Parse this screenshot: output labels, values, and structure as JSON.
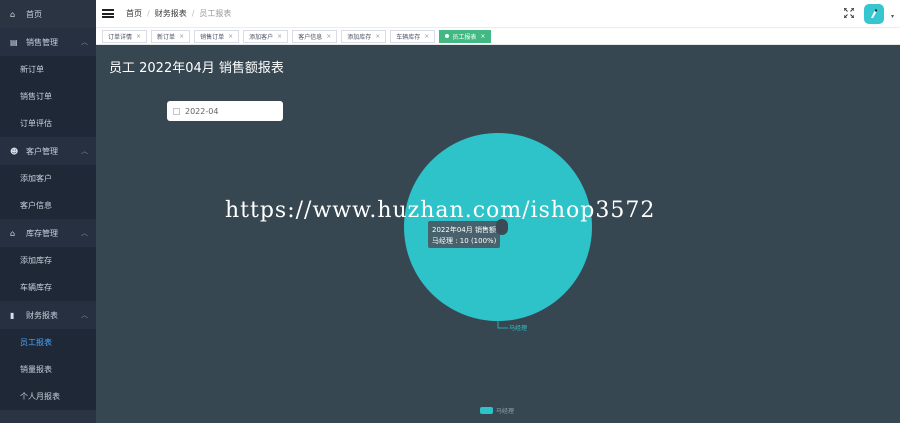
{
  "sidebar": {
    "home": "首页",
    "groups": [
      {
        "label": "销售管理",
        "icon": "chart-icon",
        "items": [
          "新订单",
          "销售订单",
          "订单评估"
        ]
      },
      {
        "label": "客户管理",
        "icon": "users-icon",
        "items": [
          "添加客户",
          "客户信息"
        ]
      },
      {
        "label": "库存管理",
        "icon": "warehouse-icon",
        "items": [
          "添加库存",
          "车辆库存"
        ]
      },
      {
        "label": "财务报表",
        "icon": "bar-chart-icon",
        "items": [
          "员工报表",
          "销量报表",
          "个人月报表"
        ]
      }
    ],
    "active_item": "员工报表"
  },
  "header": {
    "breadcrumb": [
      "首页",
      "财务报表",
      "员工报表"
    ]
  },
  "tabs": [
    {
      "label": "订单详情",
      "active": false
    },
    {
      "label": "新订单",
      "active": false
    },
    {
      "label": "销售订单",
      "active": false
    },
    {
      "label": "添加客户",
      "active": false
    },
    {
      "label": "客户信息",
      "active": false
    },
    {
      "label": "添加库存",
      "active": false
    },
    {
      "label": "车辆库存",
      "active": false
    },
    {
      "label": "员工报表",
      "active": true
    }
  ],
  "page": {
    "title": "员工 2022年04月 销售额报表",
    "date_value": "2022-04"
  },
  "watermark": "https://www.huzhan.com/ishop3572",
  "colors": {
    "pie": "#2ec3c9",
    "background": "#374752",
    "active_tab": "#42b983",
    "active_link": "#4aa3ff"
  },
  "chart_data": {
    "type": "pie",
    "title": "",
    "series": [
      {
        "name": "2022年04月 销售额",
        "values": [
          10
        ]
      }
    ],
    "categories": [
      "马经理"
    ],
    "percentages": [
      100
    ],
    "tooltip": {
      "header": "2022年04月 销售额",
      "line": "马经理 : 10 (100%)"
    },
    "legend": [
      "马经理"
    ],
    "legend_position": "bottom"
  }
}
